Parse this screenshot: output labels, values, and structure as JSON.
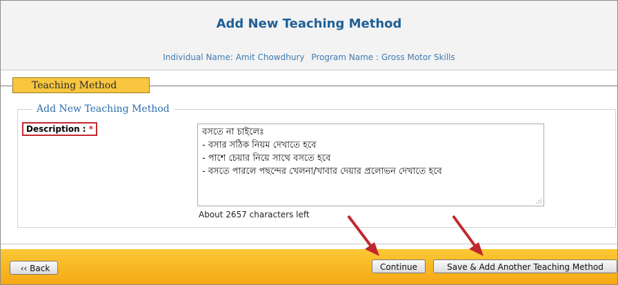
{
  "header": {
    "title": "Add New Teaching Method",
    "individual_label": "Individual Name: Amit Chowdhury",
    "program_label": "Program Name : Gross Motor Skills"
  },
  "tab": {
    "label": "Teaching Method"
  },
  "section": {
    "legend": "Add New Teaching Method"
  },
  "description": {
    "label": "Description :",
    "required_mark": "*",
    "value": "বসতে না চাইলেঃ\n- বসার সঠিক নিয়ম দেখাতে হবে\n- পাশে চেয়ার নিয়ে সাথে বসতে হবে\n- বসতে পারলে পছন্দের খেলনা/খাবার দেয়ার প্রলোভন দেখাতে হবে",
    "chars_left": "About 2657 characters left"
  },
  "footer": {
    "back_label": "‹‹ Back",
    "continue_label": "Continue",
    "save_add_label": "Save & Add Another Teaching Method"
  },
  "colors": {
    "title": "#1f5f96",
    "tab_bg": "#f8c63f",
    "footer_bg": "#f9b824",
    "required": "#d8232a",
    "annotation_arrow": "#c0272d"
  },
  "icons": {
    "annotation": "red-arrow-icon",
    "resize": "resize-grip-icon"
  }
}
